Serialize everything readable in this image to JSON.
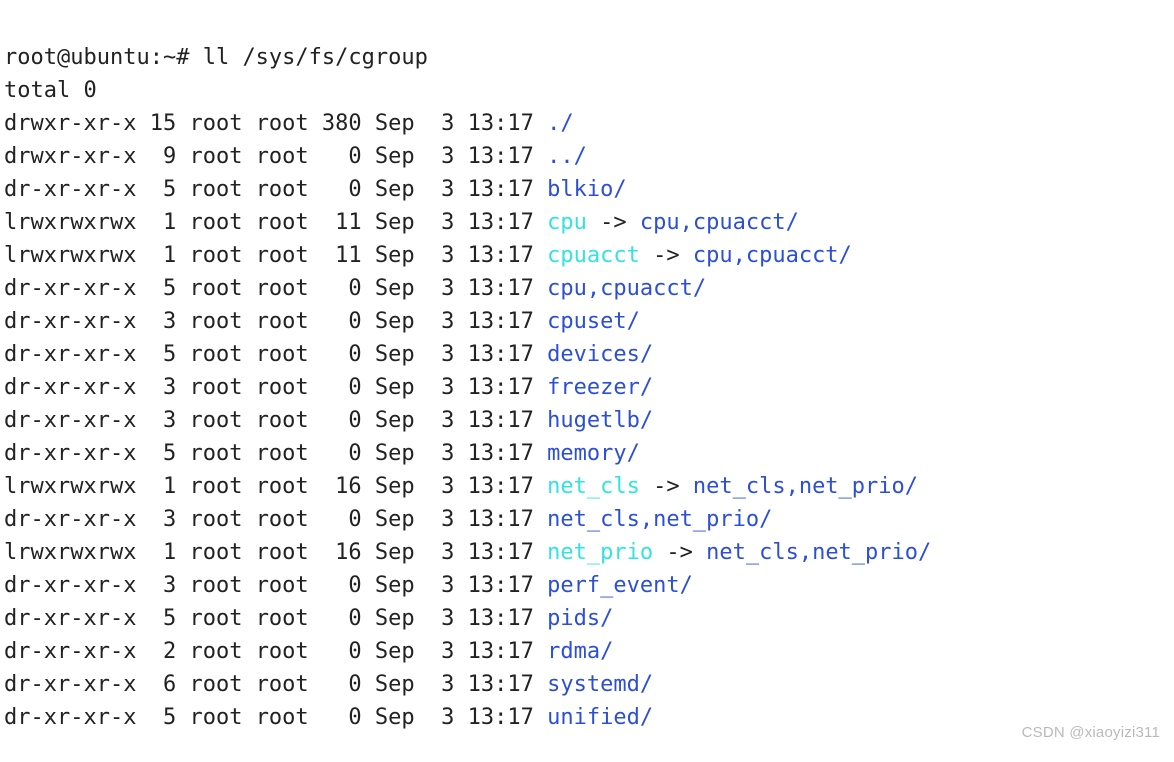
{
  "prompt": {
    "userhost": "root@ubuntu",
    "cwd": "~",
    "symbol": "#",
    "command": "ll /sys/fs/cgroup"
  },
  "total_line": "total 0",
  "entries": [
    {
      "perms": "drwxr-xr-x",
      "links": "15",
      "owner": "root",
      "group": "root",
      "size": "380",
      "month": "Sep",
      "day": "3",
      "time": "13:17",
      "name": "./",
      "type": "dir"
    },
    {
      "perms": "drwxr-xr-x",
      "links": "9",
      "owner": "root",
      "group": "root",
      "size": "0",
      "month": "Sep",
      "day": "3",
      "time": "13:17",
      "name": "../",
      "type": "dir"
    },
    {
      "perms": "dr-xr-xr-x",
      "links": "5",
      "owner": "root",
      "group": "root",
      "size": "0",
      "month": "Sep",
      "day": "3",
      "time": "13:17",
      "name": "blkio/",
      "type": "dir"
    },
    {
      "perms": "lrwxrwxrwx",
      "links": "1",
      "owner": "root",
      "group": "root",
      "size": "11",
      "month": "Sep",
      "day": "3",
      "time": "13:17",
      "name": "cpu",
      "type": "link",
      "target": "cpu,cpuacct/"
    },
    {
      "perms": "lrwxrwxrwx",
      "links": "1",
      "owner": "root",
      "group": "root",
      "size": "11",
      "month": "Sep",
      "day": "3",
      "time": "13:17",
      "name": "cpuacct",
      "type": "link",
      "target": "cpu,cpuacct/"
    },
    {
      "perms": "dr-xr-xr-x",
      "links": "5",
      "owner": "root",
      "group": "root",
      "size": "0",
      "month": "Sep",
      "day": "3",
      "time": "13:17",
      "name": "cpu,cpuacct/",
      "type": "dir"
    },
    {
      "perms": "dr-xr-xr-x",
      "links": "3",
      "owner": "root",
      "group": "root",
      "size": "0",
      "month": "Sep",
      "day": "3",
      "time": "13:17",
      "name": "cpuset/",
      "type": "dir"
    },
    {
      "perms": "dr-xr-xr-x",
      "links": "5",
      "owner": "root",
      "group": "root",
      "size": "0",
      "month": "Sep",
      "day": "3",
      "time": "13:17",
      "name": "devices/",
      "type": "dir"
    },
    {
      "perms": "dr-xr-xr-x",
      "links": "3",
      "owner": "root",
      "group": "root",
      "size": "0",
      "month": "Sep",
      "day": "3",
      "time": "13:17",
      "name": "freezer/",
      "type": "dir"
    },
    {
      "perms": "dr-xr-xr-x",
      "links": "3",
      "owner": "root",
      "group": "root",
      "size": "0",
      "month": "Sep",
      "day": "3",
      "time": "13:17",
      "name": "hugetlb/",
      "type": "dir"
    },
    {
      "perms": "dr-xr-xr-x",
      "links": "5",
      "owner": "root",
      "group": "root",
      "size": "0",
      "month": "Sep",
      "day": "3",
      "time": "13:17",
      "name": "memory/",
      "type": "dir"
    },
    {
      "perms": "lrwxrwxrwx",
      "links": "1",
      "owner": "root",
      "group": "root",
      "size": "16",
      "month": "Sep",
      "day": "3",
      "time": "13:17",
      "name": "net_cls",
      "type": "link",
      "target": "net_cls,net_prio/"
    },
    {
      "perms": "dr-xr-xr-x",
      "links": "3",
      "owner": "root",
      "group": "root",
      "size": "0",
      "month": "Sep",
      "day": "3",
      "time": "13:17",
      "name": "net_cls,net_prio/",
      "type": "dir"
    },
    {
      "perms": "lrwxrwxrwx",
      "links": "1",
      "owner": "root",
      "group": "root",
      "size": "16",
      "month": "Sep",
      "day": "3",
      "time": "13:17",
      "name": "net_prio",
      "type": "link",
      "target": "net_cls,net_prio/"
    },
    {
      "perms": "dr-xr-xr-x",
      "links": "3",
      "owner": "root",
      "group": "root",
      "size": "0",
      "month": "Sep",
      "day": "3",
      "time": "13:17",
      "name": "perf_event/",
      "type": "dir"
    },
    {
      "perms": "dr-xr-xr-x",
      "links": "5",
      "owner": "root",
      "group": "root",
      "size": "0",
      "month": "Sep",
      "day": "3",
      "time": "13:17",
      "name": "pids/",
      "type": "dir"
    },
    {
      "perms": "dr-xr-xr-x",
      "links": "2",
      "owner": "root",
      "group": "root",
      "size": "0",
      "month": "Sep",
      "day": "3",
      "time": "13:17",
      "name": "rdma/",
      "type": "dir"
    },
    {
      "perms": "dr-xr-xr-x",
      "links": "6",
      "owner": "root",
      "group": "root",
      "size": "0",
      "month": "Sep",
      "day": "3",
      "time": "13:17",
      "name": "systemd/",
      "type": "dir"
    },
    {
      "perms": "dr-xr-xr-x",
      "links": "5",
      "owner": "root",
      "group": "root",
      "size": "0",
      "month": "Sep",
      "day": "3",
      "time": "13:17",
      "name": "unified/",
      "type": "dir"
    }
  ],
  "watermark": "CSDN @xiaoyizi311"
}
